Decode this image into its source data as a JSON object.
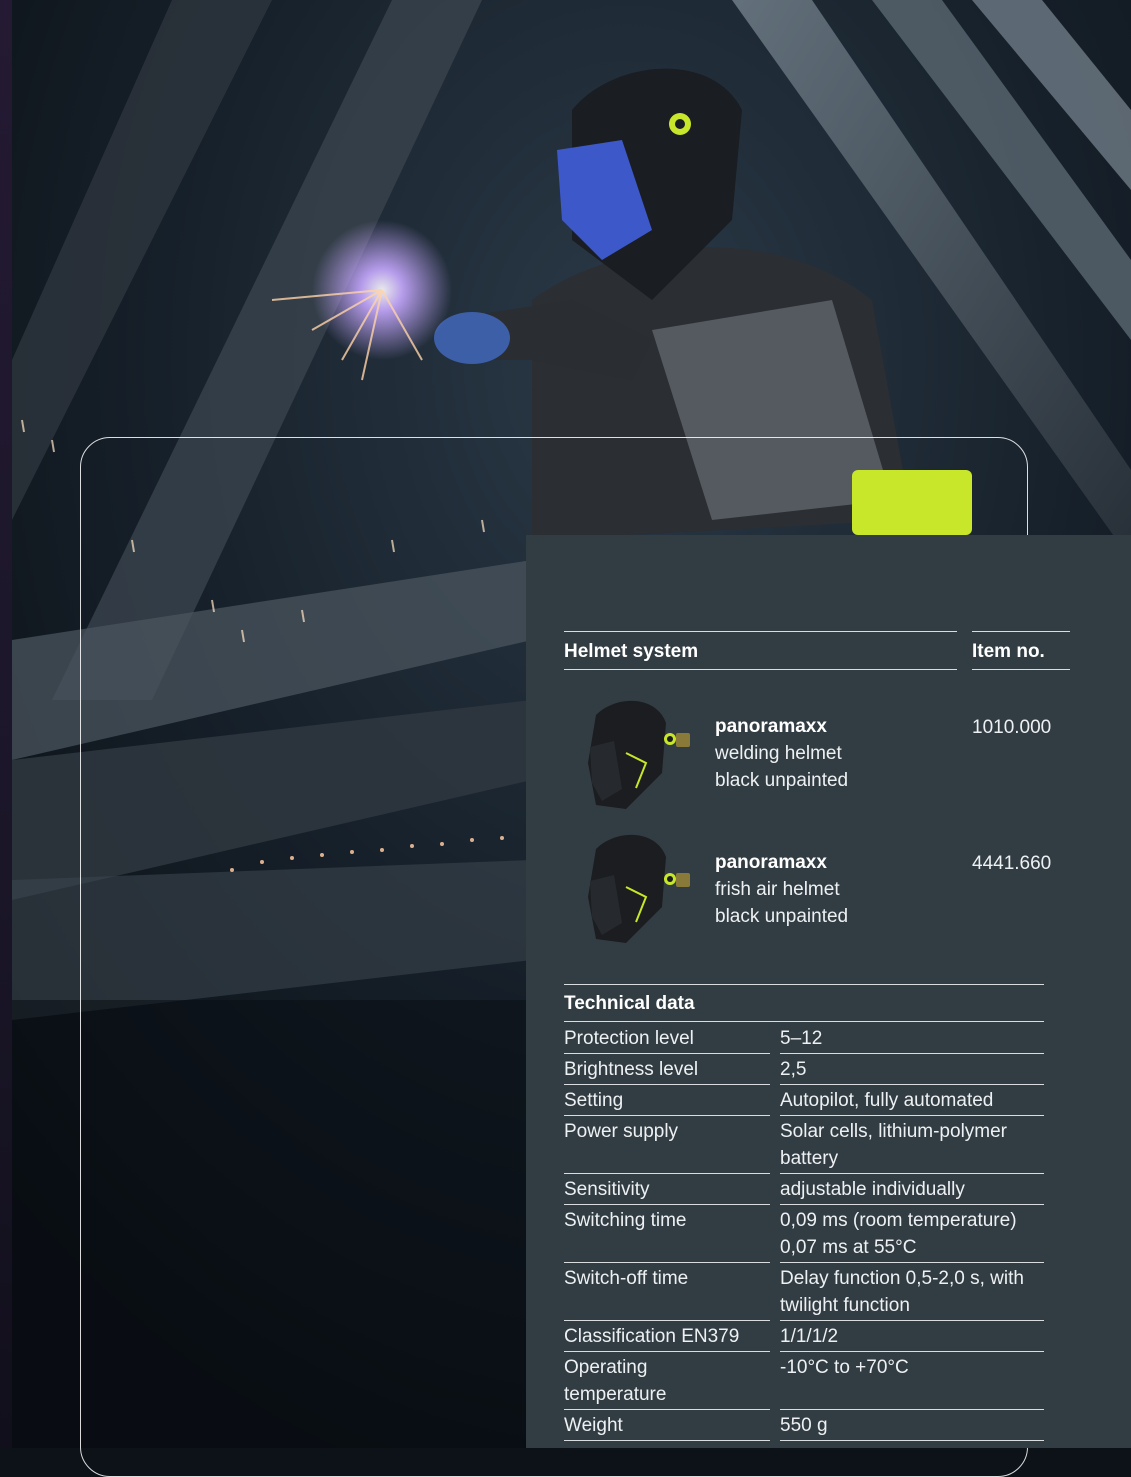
{
  "helmet_table": {
    "header_system": "Helmet system",
    "header_item": "Item no.",
    "products": [
      {
        "name": "panoramaxx",
        "line2": "welding helmet",
        "line3": "black unpainted",
        "item_no": "1010.000"
      },
      {
        "name": "panoramaxx",
        "line2": "frish air helmet",
        "line3": "black unpainted",
        "item_no": "4441.660"
      }
    ]
  },
  "technical_data": {
    "title": "Technical data",
    "rows": [
      {
        "label": "Protection level",
        "value": "5–12"
      },
      {
        "label": "Brightness level",
        "value": "2,5"
      },
      {
        "label": "Setting",
        "value": "Autopilot, fully automated"
      },
      {
        "label": "Power supply",
        "value": "Solar cells, lithium-polymer battery"
      },
      {
        "label": "Sensitivity",
        "value": "adjustable individually"
      },
      {
        "label": "Switching time",
        "value": "0,09 ms (room temperature) 0,07 ms at 55°C"
      },
      {
        "label": "Switch-off time",
        "value": "Delay function 0,5-2,0 s, with twilight function"
      },
      {
        "label": "Classification EN379",
        "value": "1/1/1/2"
      },
      {
        "label": "Operating temperature",
        "value": "-10°C to +70°C"
      },
      {
        "label": "Weight",
        "value": "550 g"
      }
    ]
  },
  "colors": {
    "panel": "#323d43",
    "text": "#ffffff",
    "rule": "#d9dde0",
    "helmet_accent": "#c8e62a"
  }
}
